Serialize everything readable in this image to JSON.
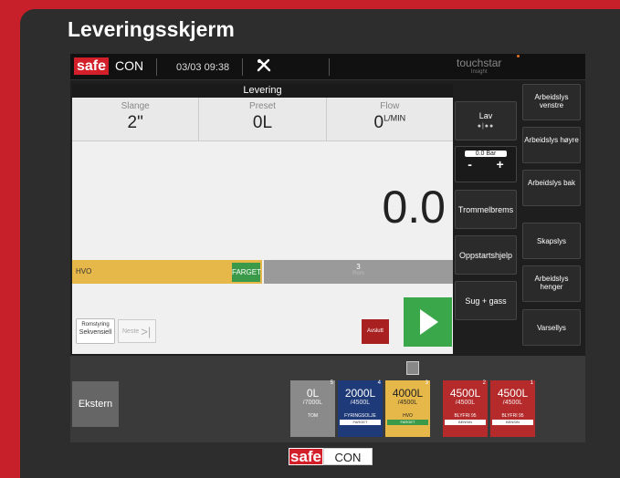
{
  "title": "Leveringsskjerm",
  "topbar": {
    "brand_safe": "safe",
    "brand_con": "CON",
    "datetime": "03/03 09:38",
    "vendor": "touchstar",
    "vendor_sub": "Insight"
  },
  "main": {
    "header": "Levering",
    "stats": [
      {
        "label": "Slange",
        "value": "2\"",
        "unit": ""
      },
      {
        "label": "Preset",
        "value": "0L",
        "unit": ""
      },
      {
        "label": "Flow",
        "value": "0",
        "unit": "L/MIN"
      }
    ],
    "volume": "0.0",
    "product_bar": {
      "label": "HVO",
      "button": "FARGET"
    },
    "compartment_bar": {
      "number": "3",
      "sub": "Rom"
    },
    "mode_button": {
      "line1": "Romstyring",
      "line2": "Sekvensiell"
    },
    "next_button": "Neste",
    "end_button": "Avslutt"
  },
  "controls": {
    "lav": {
      "label": "Lav",
      "dots": "●|●●"
    },
    "pressure": {
      "value": "0.0 Bar",
      "minus": "-",
      "plus": "+"
    },
    "buttons": [
      "Trommelbrems",
      "Oppstartshjelp",
      "Sug + gass"
    ]
  },
  "side_buttons": [
    "Arbeidslys venstre",
    "Arbeidslys høyre",
    "Arbeidslys bak",
    "Skapslys",
    "Arbeidslys henger",
    "Varsellys"
  ],
  "bottom": {
    "ekstern": "Ekstern",
    "tanks": [
      {
        "num": "5",
        "volume": "0L",
        "capacity": "/7000L",
        "product": "TOM",
        "tag": "",
        "color": "#8a8a8a"
      },
      {
        "num": "4",
        "volume": "2000L",
        "capacity": "/4500L",
        "product": "FYRINGSOLJE",
        "tag": "FARGET",
        "color": "#1f3a78"
      },
      {
        "num": "3",
        "volume": "4000L",
        "capacity": "/4500L",
        "product": "HVO",
        "tag": "FARGET",
        "color": "#e6b84a"
      },
      {
        "num": "2",
        "volume": "4500L",
        "capacity": "/4500L",
        "product": "BLYFRI 95",
        "tag": "BENSIN",
        "color": "#b52a2a"
      },
      {
        "num": "1",
        "volume": "4500L",
        "capacity": "/4500L",
        "product": "BLYFRI 95",
        "tag": "BENSIN",
        "color": "#b52a2a"
      }
    ]
  },
  "footer": {
    "safe": "safe",
    "con": "CON"
  },
  "colors": {
    "brand_red": "#c8202a",
    "go_green": "#3aa84a"
  }
}
